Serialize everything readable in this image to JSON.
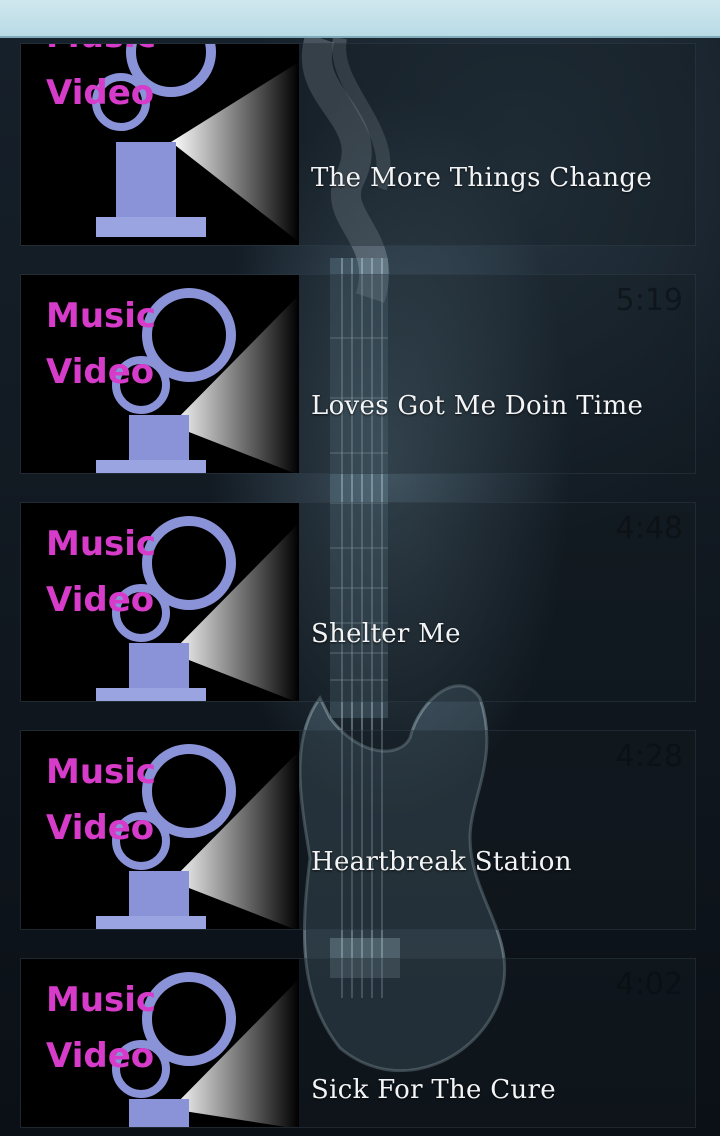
{
  "thumbnail": {
    "line1": "Music",
    "line2": "Video",
    "icon": "film-projector-icon"
  },
  "videos": [
    {
      "title": "The More Things Change",
      "duration": ""
    },
    {
      "title": "Loves Got Me Doin Time",
      "duration": "5:19"
    },
    {
      "title": "Shelter Me",
      "duration": "4:48"
    },
    {
      "title": "Heartbreak Station",
      "duration": "4:28"
    },
    {
      "title": "Sick For The Cure",
      "duration": "4:02"
    }
  ],
  "colors": {
    "thumb_text": "#d63cc9",
    "topbar": "#c4e3ec",
    "projector": "#8a93d8"
  }
}
